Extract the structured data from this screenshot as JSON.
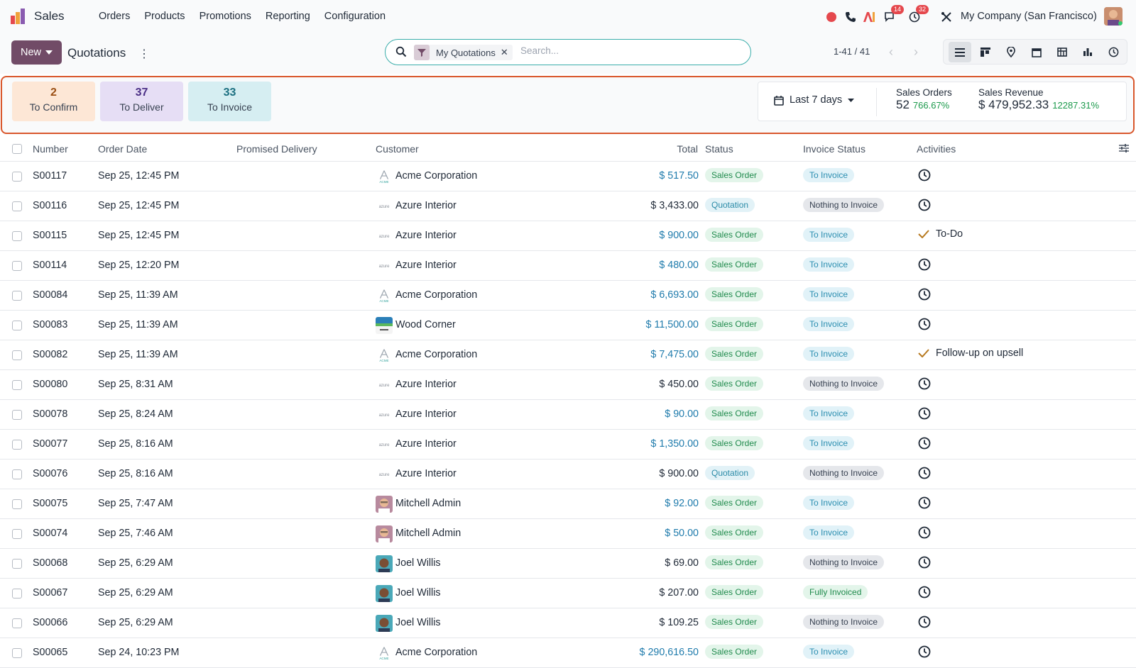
{
  "app": {
    "name": "Sales"
  },
  "menu": [
    "Orders",
    "Products",
    "Promotions",
    "Reporting",
    "Configuration"
  ],
  "systray": {
    "messages_count": "14",
    "activities_count": "32",
    "company": "My Company (San Francisco)"
  },
  "control": {
    "new_label": "New",
    "breadcrumb": "Quotations",
    "search": {
      "facet": "My Quotations",
      "placeholder": "Search..."
    },
    "pager": "1-41 / 41"
  },
  "dashboard": {
    "tiles": [
      {
        "count": "2",
        "label": "To Confirm",
        "bg": "#fde7d6",
        "fg": "#9a4f14"
      },
      {
        "count": "37",
        "label": "To Deliver",
        "bg": "#e6def5",
        "fg": "#4b2f86"
      },
      {
        "count": "33",
        "label": "To Invoice",
        "bg": "#d6eef2",
        "fg": "#1b6f80"
      }
    ],
    "period": "Last 7 days",
    "kpis": [
      {
        "label": "Sales Orders",
        "value": "52",
        "delta": "766.67%"
      },
      {
        "label": "Sales Revenue",
        "value": "$ 479,952.33",
        "delta": "12287.31%"
      }
    ]
  },
  "table": {
    "headers": {
      "number": "Number",
      "order_date": "Order Date",
      "promised": "Promised Delivery",
      "customer": "Customer",
      "total": "Total",
      "status": "Status",
      "invoice_status": "Invoice Status",
      "activities": "Activities"
    },
    "rows": [
      {
        "number": "S00117",
        "date": "Sep 25, 12:45 PM",
        "customer": "Acme Corporation",
        "logo": "acme",
        "total": "$ 517.50",
        "accent": true,
        "status": "Sales Order",
        "invoice": "To Invoice",
        "activity": ""
      },
      {
        "number": "S00116",
        "date": "Sep 25, 12:45 PM",
        "customer": "Azure Interior",
        "logo": "azure",
        "total": "$ 3,433.00",
        "accent": false,
        "status": "Quotation",
        "invoice": "Nothing to Invoice",
        "activity": ""
      },
      {
        "number": "S00115",
        "date": "Sep 25, 12:45 PM",
        "customer": "Azure Interior",
        "logo": "azure",
        "total": "$ 900.00",
        "accent": true,
        "status": "Sales Order",
        "invoice": "To Invoice",
        "activity": "To-Do"
      },
      {
        "number": "S00114",
        "date": "Sep 25, 12:20 PM",
        "customer": "Azure Interior",
        "logo": "azure",
        "total": "$ 480.00",
        "accent": true,
        "status": "Sales Order",
        "invoice": "To Invoice",
        "activity": ""
      },
      {
        "number": "S00084",
        "date": "Sep 25, 11:39 AM",
        "customer": "Acme Corporation",
        "logo": "acme",
        "total": "$ 6,693.00",
        "accent": true,
        "status": "Sales Order",
        "invoice": "To Invoice",
        "activity": ""
      },
      {
        "number": "S00083",
        "date": "Sep 25, 11:39 AM",
        "customer": "Wood Corner",
        "logo": "wood",
        "total": "$ 11,500.00",
        "accent": true,
        "status": "Sales Order",
        "invoice": "To Invoice",
        "activity": ""
      },
      {
        "number": "S00082",
        "date": "Sep 25, 11:39 AM",
        "customer": "Acme Corporation",
        "logo": "acme",
        "total": "$ 7,475.00",
        "accent": true,
        "status": "Sales Order",
        "invoice": "To Invoice",
        "activity": "Follow-up on upsell"
      },
      {
        "number": "S00080",
        "date": "Sep 25, 8:31 AM",
        "customer": "Azure Interior",
        "logo": "azure",
        "total": "$ 450.00",
        "accent": false,
        "status": "Sales Order",
        "invoice": "Nothing to Invoice",
        "activity": ""
      },
      {
        "number": "S00078",
        "date": "Sep 25, 8:24 AM",
        "customer": "Azure Interior",
        "logo": "azure",
        "total": "$ 90.00",
        "accent": true,
        "status": "Sales Order",
        "invoice": "To Invoice",
        "activity": ""
      },
      {
        "number": "S00077",
        "date": "Sep 25, 8:16 AM",
        "customer": "Azure Interior",
        "logo": "azure",
        "total": "$ 1,350.00",
        "accent": true,
        "status": "Sales Order",
        "invoice": "To Invoice",
        "activity": ""
      },
      {
        "number": "S00076",
        "date": "Sep 25, 8:16 AM",
        "customer": "Azure Interior",
        "logo": "azure",
        "total": "$ 900.00",
        "accent": false,
        "status": "Quotation",
        "invoice": "Nothing to Invoice",
        "activity": ""
      },
      {
        "number": "S00075",
        "date": "Sep 25, 7:47 AM",
        "customer": "Mitchell Admin",
        "logo": "mitchell",
        "total": "$ 92.00",
        "accent": true,
        "status": "Sales Order",
        "invoice": "To Invoice",
        "activity": ""
      },
      {
        "number": "S00074",
        "date": "Sep 25, 7:46 AM",
        "customer": "Mitchell Admin",
        "logo": "mitchell",
        "total": "$ 50.00",
        "accent": true,
        "status": "Sales Order",
        "invoice": "To Invoice",
        "activity": ""
      },
      {
        "number": "S00068",
        "date": "Sep 25, 6:29 AM",
        "customer": "Joel Willis",
        "logo": "joel",
        "total": "$ 69.00",
        "accent": false,
        "status": "Sales Order",
        "invoice": "Nothing to Invoice",
        "activity": ""
      },
      {
        "number": "S00067",
        "date": "Sep 25, 6:29 AM",
        "customer": "Joel Willis",
        "logo": "joel",
        "total": "$ 207.00",
        "accent": false,
        "status": "Sales Order",
        "invoice": "Fully Invoiced",
        "activity": ""
      },
      {
        "number": "S00066",
        "date": "Sep 25, 6:29 AM",
        "customer": "Joel Willis",
        "logo": "joel",
        "total": "$ 109.25",
        "accent": false,
        "status": "Sales Order",
        "invoice": "Nothing to Invoice",
        "activity": ""
      },
      {
        "number": "S00065",
        "date": "Sep 24, 10:23 PM",
        "customer": "Acme Corporation",
        "logo": "acme",
        "total": "$ 290,616.50",
        "accent": true,
        "status": "Sales Order",
        "invoice": "To Invoice",
        "activity": ""
      }
    ]
  }
}
